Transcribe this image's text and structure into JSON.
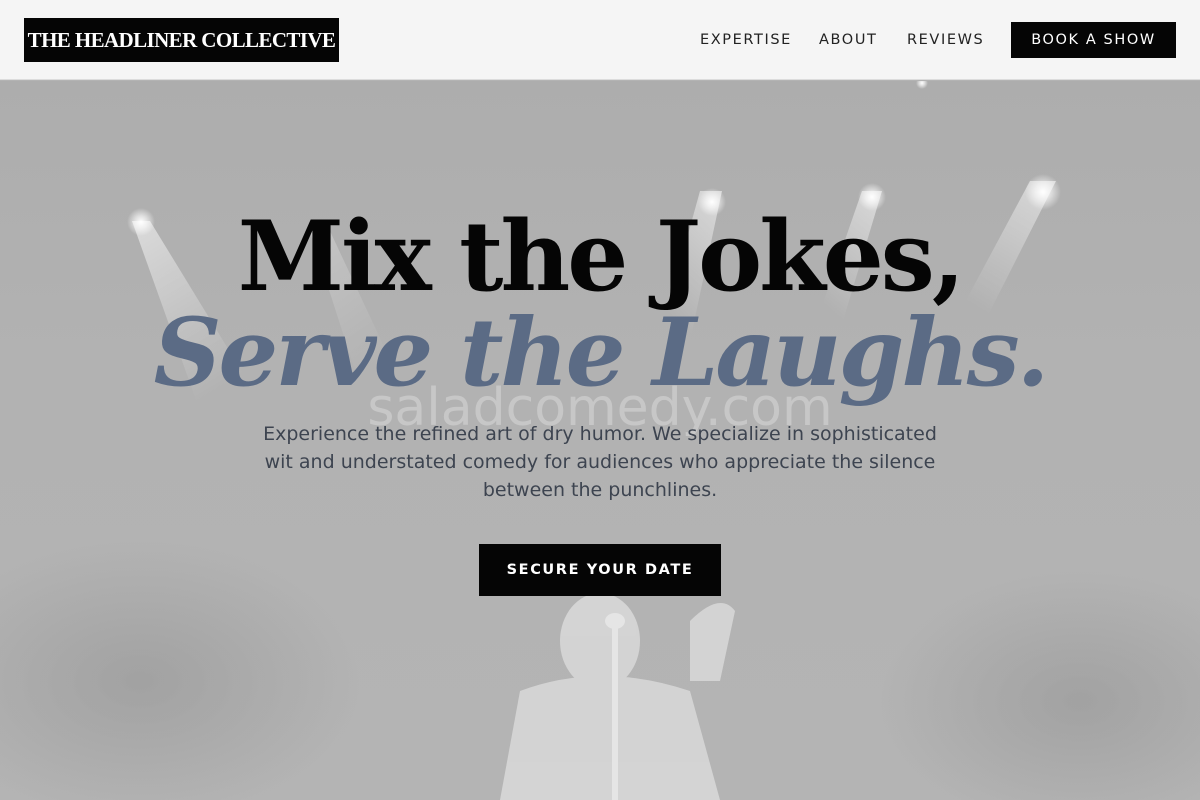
{
  "header": {
    "logo": "THE HEADLINER COLLECTIVE",
    "nav": {
      "expertise": "EXPERTISE",
      "about": "ABOUT",
      "reviews": "REVIEWS"
    },
    "book_button": "BOOK A SHOW"
  },
  "hero": {
    "headline_line1": "Mix the Jokes,",
    "headline_line2": "Serve the Laughs.",
    "watermark": "saladcomedy.com",
    "subtext": "Experience the refined art of dry humor. We specialize in sophisticated wit and understated comedy for audiences who appreciate the silence between the punchlines.",
    "cta": "SECURE YOUR DATE"
  },
  "colors": {
    "header_bg": "#f5f5f5",
    "button_bg": "#050505",
    "accent_text": "#5b6b85",
    "hero_bg": "#b3b3b3"
  }
}
